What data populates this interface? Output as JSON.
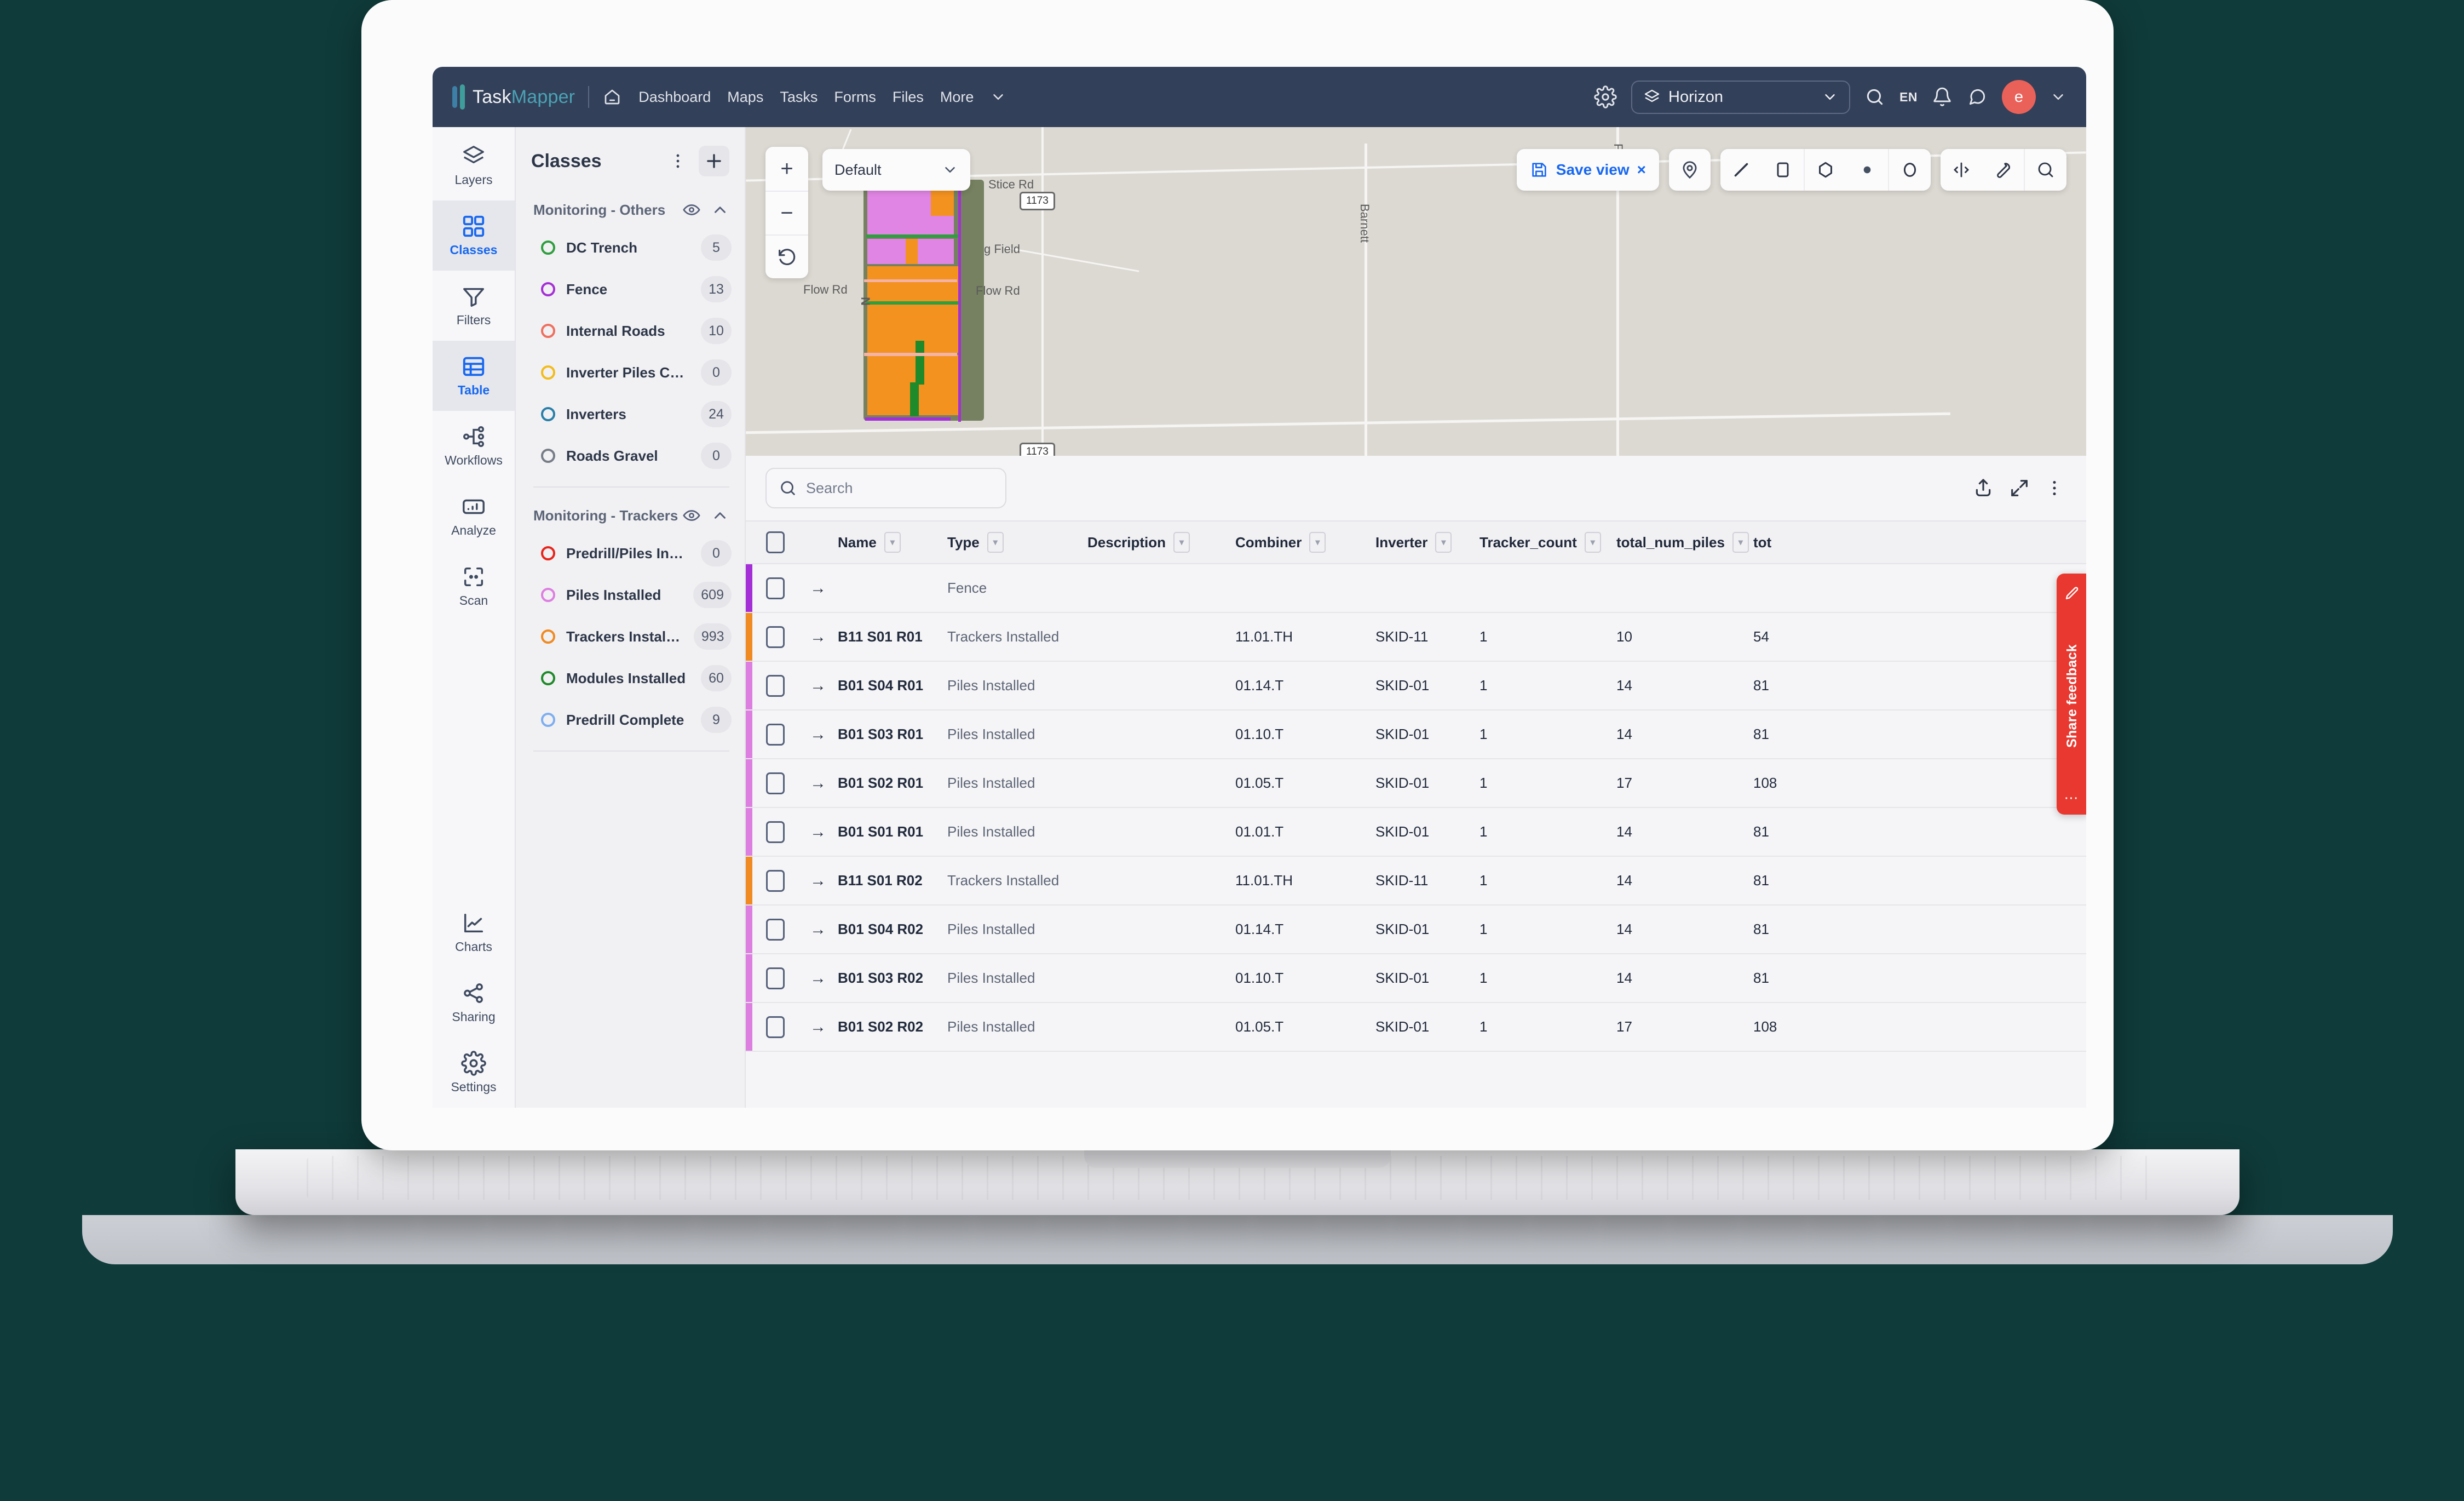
{
  "topnav": {
    "brand_task": "Task",
    "brand_mapper": "Mapper",
    "links": [
      {
        "label": "Dashboard",
        "icon": "home-icon"
      },
      {
        "label": "Maps",
        "icon": ""
      },
      {
        "label": "Tasks",
        "icon": ""
      },
      {
        "label": "Forms",
        "icon": ""
      },
      {
        "label": "Files",
        "icon": ""
      },
      {
        "label": "More",
        "icon": "chevron-down-icon"
      }
    ],
    "workspace": "Horizon",
    "language": "EN",
    "avatar_initial": "e",
    "icons": [
      "gear-icon",
      "search-icon",
      "bell-icon",
      "chat-icon",
      "chevron-down-icon"
    ]
  },
  "rail": {
    "items": [
      {
        "label": "Layers",
        "icon": "layers-icon",
        "active": false
      },
      {
        "label": "Classes",
        "icon": "grid-icon",
        "active": true
      },
      {
        "label": "Filters",
        "icon": "funnel-icon",
        "active": false
      },
      {
        "label": "Table",
        "icon": "table-icon",
        "active": true
      },
      {
        "label": "Workflows",
        "icon": "workflow-icon",
        "active": false
      },
      {
        "label": "Analyze",
        "icon": "analyze-icon",
        "active": false
      },
      {
        "label": "Scan",
        "icon": "scan-icon",
        "active": false
      }
    ],
    "bottom_items": [
      {
        "label": "Charts",
        "icon": "chart-line-icon"
      },
      {
        "label": "Sharing",
        "icon": "share-icon"
      },
      {
        "label": "Settings",
        "icon": "gear-icon"
      }
    ]
  },
  "classes_panel": {
    "title": "Classes",
    "menu_icon": "kebab-menu-icon",
    "add_icon": "plus-icon",
    "groups": [
      {
        "title": "Monitoring - Others",
        "eye_icon": "eye-icon",
        "collapse_icon": "chevron-up-icon",
        "items": [
          {
            "label": "DC Trench",
            "count": "5",
            "color": "#2f9e3f"
          },
          {
            "label": "Fence",
            "count": "13",
            "color": "#a52fd6"
          },
          {
            "label": "Internal Roads",
            "count": "10",
            "color": "#ef6f5e"
          },
          {
            "label": "Inverter Piles Compl...",
            "count": "0",
            "color": "#f2bc1b"
          },
          {
            "label": "Inverters",
            "count": "24",
            "color": "#2a7fa8"
          },
          {
            "label": "Roads Gravel",
            "count": "0",
            "color": "#777d87"
          }
        ]
      },
      {
        "title": "Monitoring - Trackers",
        "eye_icon": "eye-icon",
        "collapse_icon": "chevron-up-icon",
        "items": [
          {
            "label": "Predrill/Piles Incom...",
            "count": "0",
            "color": "#e8241b"
          },
          {
            "label": "Piles Installed",
            "count": "609",
            "color": "#dd7fe0"
          },
          {
            "label": "Trackers Installed",
            "count": "993",
            "color": "#f08a22"
          },
          {
            "label": "Modules Installed",
            "count": "60",
            "color": "#1f8a2a"
          },
          {
            "label": "Predrill Complete",
            "count": "9",
            "color": "#7eaef0"
          }
        ]
      }
    ]
  },
  "map": {
    "zoom_in": "+",
    "zoom_out": "−",
    "reset_icon": "reset-rotation-icon",
    "view_selected": "Default",
    "view_chevron": "chevron-down-icon",
    "save_view_label": "Save view",
    "save_view_icon": "save-icon",
    "save_view_close": "×",
    "pin_icon": "map-pin-icon",
    "draw_tools": [
      "line-icon",
      "rectangle-icon",
      "polygon-icon",
      "point-icon",
      "circle-icon"
    ],
    "right_tools": [
      "measure-icon",
      "wrench-icon",
      "search-icon"
    ],
    "labels": [
      "Stice Rd",
      "Barnett",
      "Fr Rd",
      "g Field",
      "Flow Rd",
      "Flow Rd",
      "N"
    ],
    "highway_shields": [
      "1173",
      "1173"
    ],
    "site_colors": {
      "trackers": "#f3921f",
      "piles": "#e085e3",
      "fence": "#a52fd6",
      "dc_trench": "#2f9e3f",
      "modules": "#1f8a2a"
    }
  },
  "table": {
    "search_placeholder": "Search",
    "toolbar_icons": [
      "upload-icon",
      "expand-icon",
      "kebab-menu-icon"
    ],
    "columns": [
      {
        "key": "name",
        "label": "Name",
        "filter": true
      },
      {
        "key": "type",
        "label": "Type",
        "filter": true
      },
      {
        "key": "description",
        "label": "Description",
        "filter": true
      },
      {
        "key": "combiner",
        "label": "Combiner",
        "filter": true
      },
      {
        "key": "inverter",
        "label": "Inverter",
        "filter": true
      },
      {
        "key": "tracker_count",
        "label": "Tracker_count",
        "filter": true
      },
      {
        "key": "total_num_piles",
        "label": "total_num_piles",
        "filter": true
      },
      {
        "key": "total",
        "label": "tot",
        "filter": true
      }
    ],
    "rows": [
      {
        "accent": "#a52fd6",
        "name": "",
        "type": "Fence",
        "description": "",
        "combiner": "",
        "inverter": "",
        "tracker_count": "",
        "total_num_piles": "",
        "total": ""
      },
      {
        "accent": "#f08a22",
        "name": "B11 S01 R01",
        "type": "Trackers Installed",
        "description": "",
        "combiner": "11.01.TH",
        "inverter": "SKID-11",
        "tracker_count": "1",
        "total_num_piles": "10",
        "total": "54"
      },
      {
        "accent": "#dd7fe0",
        "name": "B01 S04 R01",
        "type": "Piles Installed",
        "description": "",
        "combiner": "01.14.T",
        "inverter": "SKID-01",
        "tracker_count": "1",
        "total_num_piles": "14",
        "total": "81"
      },
      {
        "accent": "#dd7fe0",
        "name": "B01 S03 R01",
        "type": "Piles Installed",
        "description": "",
        "combiner": "01.10.T",
        "inverter": "SKID-01",
        "tracker_count": "1",
        "total_num_piles": "14",
        "total": "81"
      },
      {
        "accent": "#dd7fe0",
        "name": "B01 S02 R01",
        "type": "Piles Installed",
        "description": "",
        "combiner": "01.05.T",
        "inverter": "SKID-01",
        "tracker_count": "1",
        "total_num_piles": "17",
        "total": "108"
      },
      {
        "accent": "#dd7fe0",
        "name": "B01 S01 R01",
        "type": "Piles Installed",
        "description": "",
        "combiner": "01.01.T",
        "inverter": "SKID-01",
        "tracker_count": "1",
        "total_num_piles": "14",
        "total": "81"
      },
      {
        "accent": "#f08a22",
        "name": "B11 S01 R02",
        "type": "Trackers Installed",
        "description": "",
        "combiner": "11.01.TH",
        "inverter": "SKID-11",
        "tracker_count": "1",
        "total_num_piles": "14",
        "total": "81"
      },
      {
        "accent": "#dd7fe0",
        "name": "B01 S04 R02",
        "type": "Piles Installed",
        "description": "",
        "combiner": "01.14.T",
        "inverter": "SKID-01",
        "tracker_count": "1",
        "total_num_piles": "14",
        "total": "81"
      },
      {
        "accent": "#dd7fe0",
        "name": "B01 S03 R02",
        "type": "Piles Installed",
        "description": "",
        "combiner": "01.10.T",
        "inverter": "SKID-01",
        "tracker_count": "1",
        "total_num_piles": "14",
        "total": "81"
      },
      {
        "accent": "#dd7fe0",
        "name": "B01 S02 R02",
        "type": "Piles Installed",
        "description": "",
        "combiner": "01.05.T",
        "inverter": "SKID-01",
        "tracker_count": "1",
        "total_num_piles": "17",
        "total": "108"
      }
    ]
  },
  "feedback": {
    "label": "Share feedback",
    "icon": "pencil-icon",
    "drag_dots": "⋯"
  },
  "colors": {
    "navbar": "#334059",
    "accent_blue": "#1767f0",
    "feedback_red": "#e8382f",
    "avatar_red": "#ea6159"
  }
}
